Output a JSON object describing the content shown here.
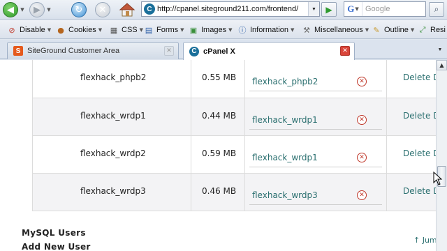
{
  "browser": {
    "url": "http://cpanel.siteground211.com/frontend/",
    "search_placeholder": "Google",
    "search_engine_letter": "G"
  },
  "devbar": {
    "items": [
      {
        "label": "Disable",
        "icon": "no-entry-icon"
      },
      {
        "label": "Cookies",
        "icon": "person-icon"
      },
      {
        "label": "CSS",
        "icon": "css-icon"
      },
      {
        "label": "Forms",
        "icon": "form-icon"
      },
      {
        "label": "Images",
        "icon": "image-icon"
      },
      {
        "label": "Information",
        "icon": "info-icon"
      },
      {
        "label": "Miscellaneous",
        "icon": "tools-icon"
      },
      {
        "label": "Outline",
        "icon": "pencil-icon"
      },
      {
        "label": "Resi",
        "icon": "resize-icon"
      }
    ]
  },
  "tabs": [
    {
      "label": "SiteGround Customer Area",
      "icon_letter": "S",
      "active": false
    },
    {
      "label": "cPanel X",
      "icon_letter": "C",
      "active": true
    }
  ],
  "databases": {
    "rows": [
      {
        "name": "flexhack_phpb2",
        "size": "0.55 MB",
        "user": "flexhack_phpb2",
        "action": "Delete D"
      },
      {
        "name": "flexhack_wrdp1",
        "size": "0.44 MB",
        "user": "flexhack_wrdp1",
        "action": "Delete D"
      },
      {
        "name": "flexhack_wrdp2",
        "size": "0.59 MB",
        "user": "flexhack_wrdp1",
        "action": "Delete D"
      },
      {
        "name": "flexhack_wrdp3",
        "size": "0.46 MB",
        "user": "flexhack_wrdp3",
        "action": "Delete D"
      }
    ]
  },
  "sections": {
    "mysql_users": "MySQL Users",
    "add_new_user": "Add New User",
    "jump": "↑ Jum"
  },
  "colors": {
    "link": "#2a6f6f",
    "remove": "#c0392b",
    "alt_row": "#f3f3f5"
  }
}
